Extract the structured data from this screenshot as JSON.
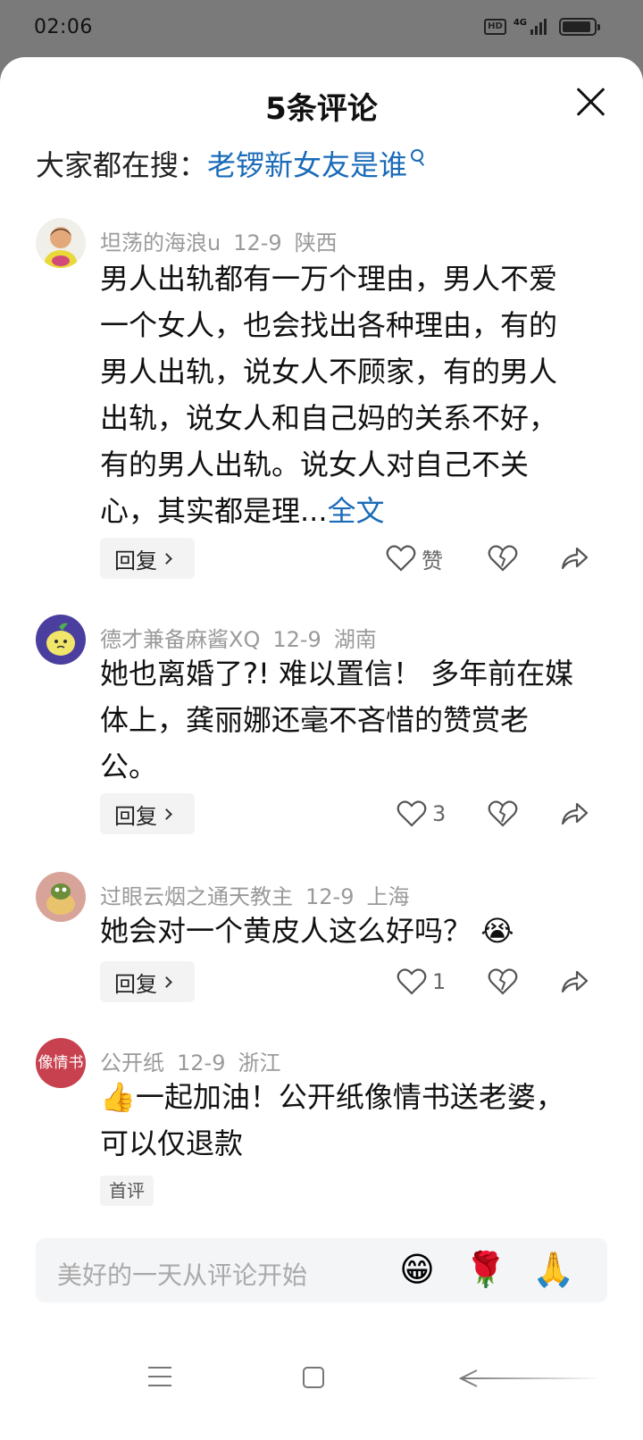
{
  "status_bar": {
    "time": "02:06",
    "hd_badge": "HD",
    "network": "4G",
    "icons": [
      "hd-icon",
      "signal-icon",
      "battery-icon"
    ]
  },
  "sheet": {
    "title": "5条评论",
    "close_icon": "close-icon"
  },
  "search": {
    "prefix": "大家都在搜：",
    "query": "老锣新女友是谁",
    "icon": "search-icon"
  },
  "comments": [
    {
      "username": "坦荡的海浪u",
      "date": "12-9",
      "location": "陕西",
      "text": "男人出轨都有一万个理由，男人不爱一个女人，也会找出各种理由，有的男人出轨，说女人不顾家，有的男人出轨，说女人和自己妈的关系不好，有的男人出轨。说女人对自己不关心，其实都是理...",
      "more_label": "全文",
      "reply_label": "回复",
      "like_label": "赞"
    },
    {
      "username": "德才兼备麻酱XQ",
      "date": "12-9",
      "location": "湖南",
      "text": "她也离婚了?! 难以置信！  多年前在媒体上，龚丽娜还毫不吝惜的赞赏老公。",
      "reply_label": "回复",
      "like_label": "3"
    },
    {
      "username": "过眼云烟之通天教主",
      "date": "12-9",
      "location": "上海",
      "text": "她会对一个黄皮人这么好吗？",
      "emoji": "😭",
      "reply_label": "回复",
      "like_label": "1"
    },
    {
      "username": "公开纸",
      "date": "12-9",
      "location": "浙江",
      "avatar_text": "像情书",
      "emoji": "👍",
      "text": "一起加油！公开纸像情书送老婆，可以仅退款",
      "badge": "首评"
    }
  ],
  "input": {
    "placeholder": "美好的一天从评论开始",
    "emojis": [
      "😁",
      "🌹",
      "🙏"
    ]
  },
  "nav": {
    "icons": [
      "menu-icon",
      "home-icon",
      "back-icon"
    ]
  },
  "colors": {
    "link": "#1a6bb8",
    "muted": "#9a9a9a",
    "text": "#111111",
    "overlay": "#7a7a7a",
    "avatar_4": "#c8414e"
  }
}
